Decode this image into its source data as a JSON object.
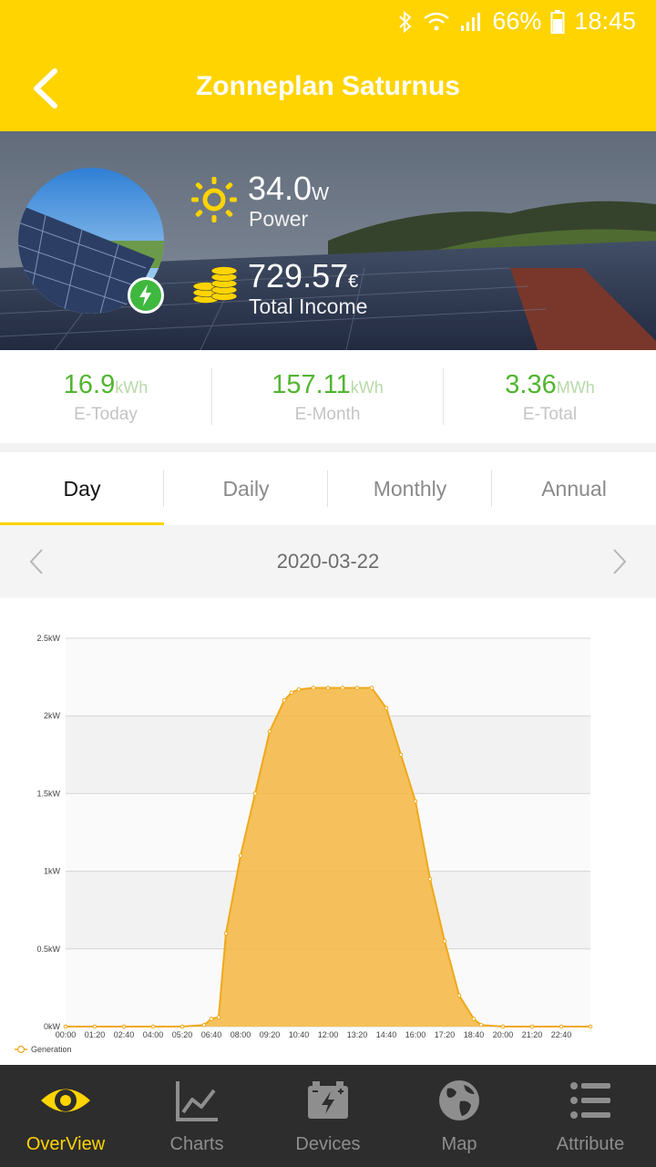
{
  "status_bar": {
    "battery": "66%",
    "time": "18:45",
    "icons": [
      "bluetooth-icon",
      "wifi-icon",
      "signal-icon",
      "battery-icon"
    ]
  },
  "header": {
    "title": "Zonneplan Saturnus",
    "back_icon": "back-arrow-icon"
  },
  "hero": {
    "power_value": "34.0",
    "power_unit": "W",
    "power_label": "Power",
    "income_value": "729.57",
    "income_unit": "€",
    "income_label": "Total Income"
  },
  "stats": [
    {
      "value": "16.9",
      "unit": "kWh",
      "label": "E-Today"
    },
    {
      "value": "157.11",
      "unit": "kWh",
      "label": "E-Month"
    },
    {
      "value": "3.36",
      "unit": "MWh",
      "label": "E-Total"
    }
  ],
  "tabs": [
    {
      "label": "Day",
      "active": true
    },
    {
      "label": "Daily",
      "active": false
    },
    {
      "label": "Monthly",
      "active": false
    },
    {
      "label": "Annual",
      "active": false
    }
  ],
  "date": "2020-03-22",
  "colors": {
    "brand": "#FFD400",
    "green": "#52b531",
    "series": "#F5B335",
    "nav_bg": "#2d2d2d"
  },
  "chart_data": {
    "type": "area",
    "title": "",
    "xlabel": "",
    "ylabel": "",
    "y_ticks": [
      "0kW",
      "0.5kW",
      "1kW",
      "1.5kW",
      "2kW",
      "2.5kW"
    ],
    "ylim": [
      0,
      2.5
    ],
    "x_ticks": [
      "00:00",
      "01:20",
      "02:40",
      "04:00",
      "05:20",
      "06:40",
      "08:00",
      "09:20",
      "10:40",
      "12:00",
      "13:20",
      "14:40",
      "16:00",
      "17:20",
      "18:40",
      "20:00",
      "21:20",
      "22:40"
    ],
    "xlim_hours": [
      0,
      24
    ],
    "grid": "banded",
    "legend": "bottom-left",
    "series": [
      {
        "name": "Generation",
        "points": [
          [
            0,
            0
          ],
          [
            1.333,
            0
          ],
          [
            2.667,
            0
          ],
          [
            4.0,
            0
          ],
          [
            5.333,
            0
          ],
          [
            6.333,
            0.01
          ],
          [
            6.667,
            0.05
          ],
          [
            7.0,
            0.06
          ],
          [
            7.333,
            0.6
          ],
          [
            8.0,
            1.1
          ],
          [
            8.667,
            1.5
          ],
          [
            9.333,
            1.9
          ],
          [
            10.0,
            2.1
          ],
          [
            10.333,
            2.15
          ],
          [
            10.667,
            2.17
          ],
          [
            11.333,
            2.18
          ],
          [
            12.0,
            2.18
          ],
          [
            12.667,
            2.18
          ],
          [
            13.333,
            2.18
          ],
          [
            14.0,
            2.18
          ],
          [
            14.667,
            2.05
          ],
          [
            15.333,
            1.75
          ],
          [
            16.0,
            1.45
          ],
          [
            16.667,
            0.95
          ],
          [
            17.333,
            0.55
          ],
          [
            18.0,
            0.2
          ],
          [
            18.667,
            0.05
          ],
          [
            19.0,
            0.01
          ],
          [
            20.0,
            0
          ],
          [
            21.333,
            0
          ],
          [
            22.667,
            0
          ],
          [
            24.0,
            0
          ]
        ]
      }
    ]
  },
  "bottom_nav": [
    {
      "label": "OverView",
      "icon": "eye-icon",
      "active": true
    },
    {
      "label": "Charts",
      "icon": "line-chart-icon",
      "active": false
    },
    {
      "label": "Devices",
      "icon": "battery-device-icon",
      "active": false
    },
    {
      "label": "Map",
      "icon": "globe-icon",
      "active": false
    },
    {
      "label": "Attribute",
      "icon": "list-icon",
      "active": false
    }
  ]
}
